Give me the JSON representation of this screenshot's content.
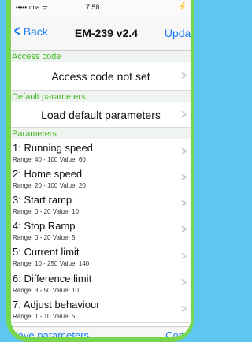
{
  "status_bar": {
    "carrier": "dna",
    "time": "7.58",
    "signal_dots": "•••••",
    "wifi": "ᯤ",
    "battery": "⚡"
  },
  "nav": {
    "back_label": "Back",
    "back_chevron": "<",
    "title": "EM-239 v2.4",
    "update_label": "Update"
  },
  "sections": {
    "access_code": {
      "header": "Access code",
      "row_label": "Access code not set"
    },
    "default_parameters": {
      "header": "Default parameters",
      "row_label": "Load default parameters"
    },
    "parameters": {
      "header": "Parameters",
      "items": [
        {
          "title": "1: Running speed",
          "range": "Range: 40 - 100 Value: 60"
        },
        {
          "title": "2: Home speed",
          "range": "Range: 20 - 100 Value: 20"
        },
        {
          "title": "3: Start ramp",
          "range": "Range: 0 - 20 Value: 10"
        },
        {
          "title": "4: Stop Ramp",
          "range": "Range: 0 - 20 Value: 5"
        },
        {
          "title": "5: Current limit",
          "range": "Range: 10 - 250 Value: 140"
        },
        {
          "title": "6: Difference limit",
          "range": "Range: 3 - 50 Value: 10"
        },
        {
          "title": "7: Adjust behaviour",
          "range": "Range: 1 - 10 Value: 5"
        }
      ]
    }
  },
  "toolbar": {
    "save_label": "Save parameters",
    "control_label": "Control"
  },
  "chevron_glyph": ">",
  "colors": {
    "accent_blue": "#1a7cf5",
    "section_green": "#40b820",
    "frame_green": "#76d64e",
    "background_blue": "#5ec6f2"
  }
}
